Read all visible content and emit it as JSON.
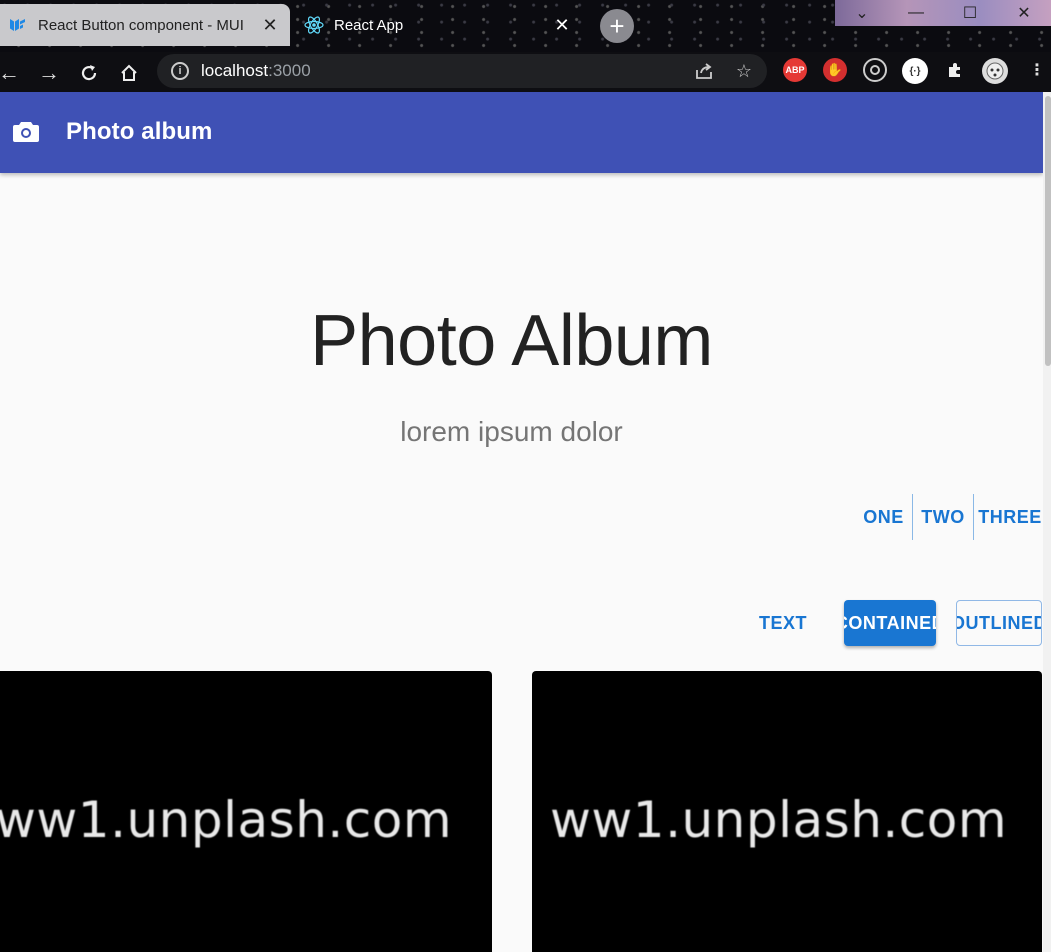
{
  "browser": {
    "tabs": [
      {
        "label": "React Button component - MUI",
        "active": true,
        "favicon": "mui-icon"
      },
      {
        "label": "React App",
        "active": false,
        "favicon": "react-icon"
      }
    ],
    "address": {
      "host": "localhost",
      "port": ":3000"
    }
  },
  "appbar": {
    "title": "Photo album",
    "icon": "camera-icon",
    "color": "#3f51b5"
  },
  "hero": {
    "title": "Photo Album",
    "subtitle": "lorem ipsum dolor"
  },
  "button_group": {
    "items": [
      "ONE",
      "TWO",
      "THREE"
    ]
  },
  "variant_buttons": {
    "text": "TEXT",
    "contained": "CONTAINED",
    "outlined": "OUTLINED"
  },
  "cards": [
    {
      "image_text": "ww1.unplash.com"
    },
    {
      "image_text": "ww1.unplash.com"
    }
  ],
  "colors": {
    "primary": "#1976d2",
    "appbar": "#3f51b5"
  }
}
